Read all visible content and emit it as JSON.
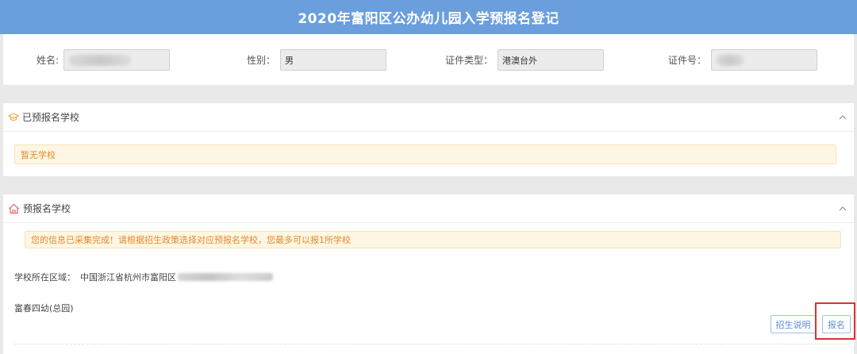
{
  "header": {
    "title": "2020年富阳区公办幼儿园入学预报名登记"
  },
  "applicant": {
    "name_label": "姓名:",
    "name_value": "",
    "gender_label": "性别：",
    "gender_value": "男",
    "id_type_label": "证件类型：",
    "id_type_value": "港澳台外",
    "id_no_label": "证件号：",
    "id_no_value": ""
  },
  "registered_section": {
    "title": "已预报名学校",
    "empty_notice": "暂无学校"
  },
  "preregister_section": {
    "title": "预报名学校",
    "notice": "您的信息已采集完成！请根据招生政策选择对应预报名学校，您最多可以报1所学校",
    "region_label": "学校所在区域：",
    "region_value": "中国浙江省杭州市富阳区",
    "school_name": "富春四幼(总园)",
    "policy_button": "招生说明",
    "apply_button": "报名"
  },
  "colors": {
    "header_bg": "#6a9edd",
    "notice_text": "#e8892b",
    "button_text": "#5b8ed4",
    "highlight": "#e03030"
  },
  "icons": {
    "registered": "graduation-cap-icon",
    "preregister": "home-icon",
    "collapse": "chevron-up-icon"
  }
}
